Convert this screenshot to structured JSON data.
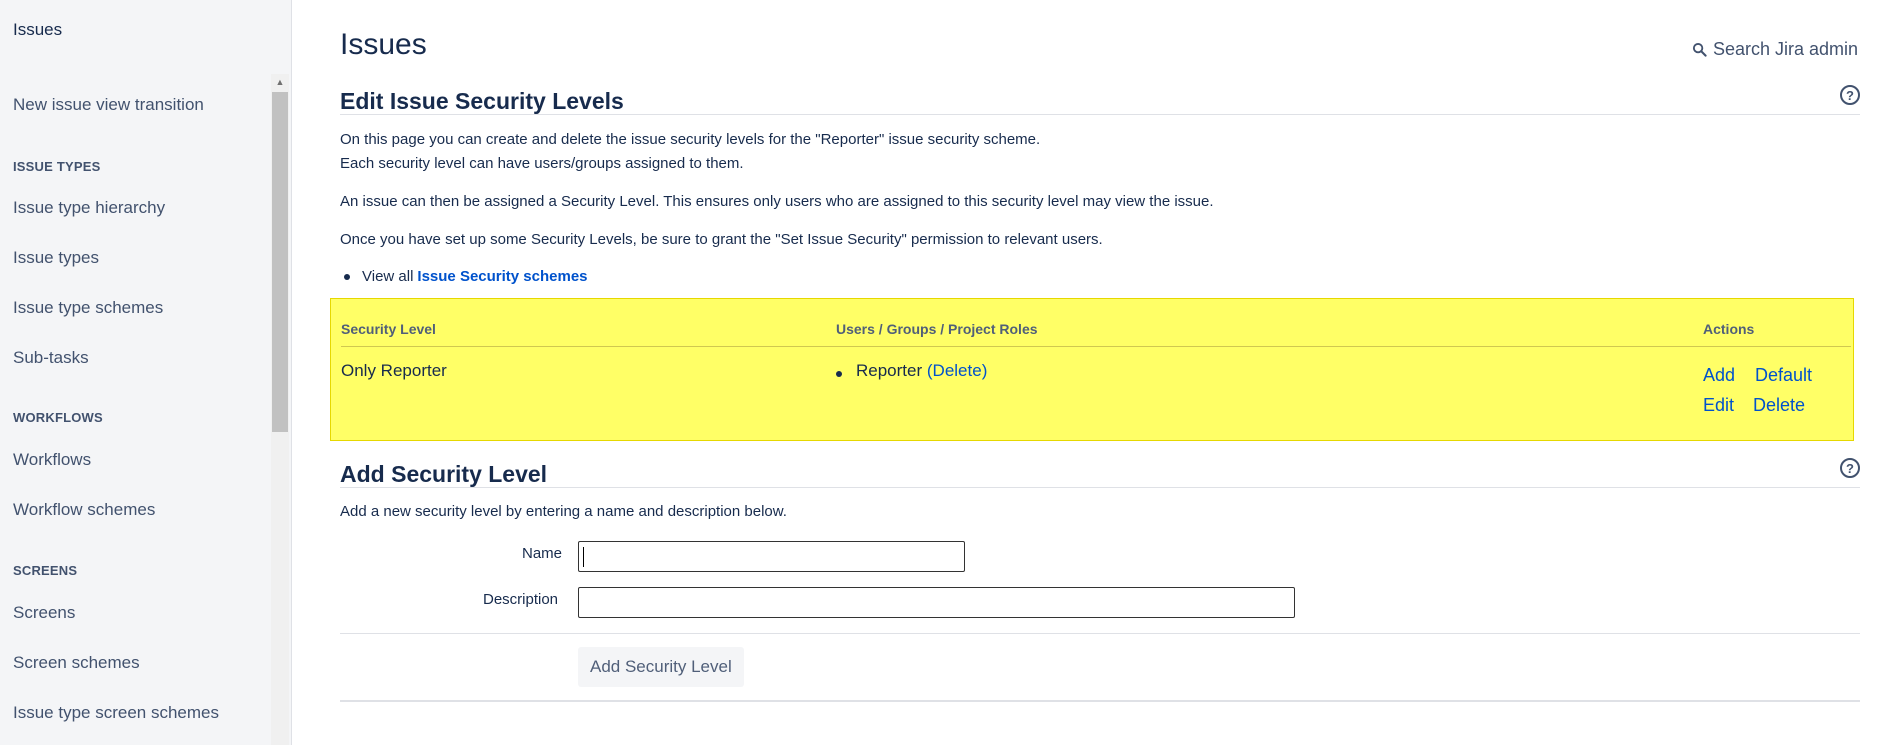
{
  "sidebar": {
    "top_item": "Issues",
    "items": [
      {
        "type": "link",
        "label": "New issue view transition"
      },
      {
        "type": "heading",
        "label": "ISSUE TYPES"
      },
      {
        "type": "link",
        "label": "Issue type hierarchy"
      },
      {
        "type": "link",
        "label": "Issue types"
      },
      {
        "type": "link",
        "label": "Issue type schemes"
      },
      {
        "type": "link",
        "label": "Sub-tasks"
      },
      {
        "type": "heading",
        "label": "WORKFLOWS"
      },
      {
        "type": "link",
        "label": "Workflows"
      },
      {
        "type": "link",
        "label": "Workflow schemes"
      },
      {
        "type": "heading",
        "label": "SCREENS"
      },
      {
        "type": "link",
        "label": "Screens"
      },
      {
        "type": "link",
        "label": "Screen schemes"
      },
      {
        "type": "link",
        "label": "Issue type screen schemes"
      }
    ]
  },
  "header": {
    "title": "Issues",
    "search_label": "Search Jira admin",
    "search_icon": "search-icon"
  },
  "edit_section": {
    "title": "Edit Issue Security Levels",
    "help_icon": "help-icon",
    "help_glyph": "?",
    "para1_line1": "On this page you can create and delete the issue security levels for the \"Reporter\" issue security scheme.",
    "para1_line2": "Each security level can have users/groups assigned to them.",
    "para2": "An issue can then be assigned a Security Level. This ensures only users who are assigned to this security level may view the issue.",
    "para3": "Once you have set up some Security Levels, be sure to grant the \"Set Issue Security\" permission to relevant users.",
    "view_all_prefix": "View all",
    "view_all_link": "Issue Security schemes"
  },
  "security_table": {
    "highlight_color": "#ffff66",
    "headers": {
      "level": "Security Level",
      "members": "Users / Groups / Project Roles",
      "actions": "Actions"
    },
    "rows": [
      {
        "level": "Only Reporter",
        "member_name": "Reporter",
        "member_open": "(",
        "member_delete": "Delete",
        "member_close": ")",
        "actions": {
          "add": "Add",
          "default": "Default",
          "edit": "Edit",
          "delete": "Delete"
        }
      }
    ]
  },
  "add_section": {
    "title": "Add Security Level",
    "help_glyph": "?",
    "description": "Add a new security level by entering a name and description below.",
    "name_label": "Name",
    "name_value": "",
    "description_label": "Description",
    "description_value": "",
    "submit_label": "Add Security Level"
  }
}
